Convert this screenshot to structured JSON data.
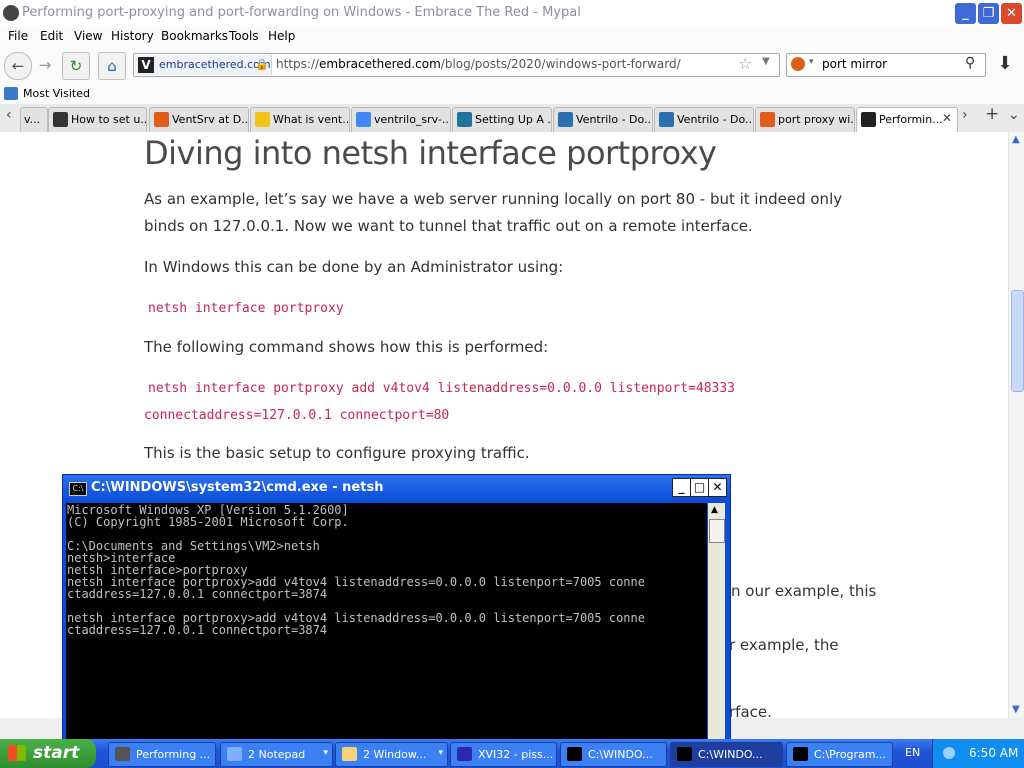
{
  "window": {
    "title": "Performing port-proxying and port-forwarding on Windows - Embrace The Red - Mypal"
  },
  "menu": [
    "File",
    "Edit",
    "View",
    "History",
    "Bookmarks",
    "Tools",
    "Help"
  ],
  "nav": {
    "identity_domain": "embracethered.com",
    "url_prefix": "https://",
    "url_host": "embracethered.com",
    "url_path": "/blog/posts/2020/windows-port-forward/",
    "search_value": "port mirror"
  },
  "bookmarks": {
    "most_visited": "Most Visited"
  },
  "tabs": [
    {
      "label": "v...",
      "color": "#cc9a33"
    },
    {
      "label": "How to set u...",
      "color": "#333333"
    },
    {
      "label": "VentSrv at D...",
      "color": "#e25d1b"
    },
    {
      "label": "What is vent...",
      "color": "#f0c419"
    },
    {
      "label": "ventrilo_srv-...",
      "color": "#4285f4"
    },
    {
      "label": "Setting Up A ...",
      "color": "#21759b"
    },
    {
      "label": "Ventrilo - Do...",
      "color": "#2a6fb0"
    },
    {
      "label": "Ventrilo - Do...",
      "color": "#2a6fb0"
    },
    {
      "label": "port proxy wi...",
      "color": "#e25d1b"
    },
    {
      "label": "Performin...",
      "color": "#222222"
    }
  ],
  "article": {
    "heading": "Diving into netsh interface portproxy",
    "p1": "As an example, let’s say we have a web server running locally on port 80 - but it indeed only binds on 127.0.0.1. Now we want to tunnel that traffic out on a remote interface.",
    "p2": "In Windows this can be done by an Administrator using:",
    "code1": "netsh interface portproxy",
    "p3": "The following command shows how this is performed:",
    "code2_line1": "netsh interface portproxy add v4tov4 listenaddress=0.0.0.0 listenport=48333",
    "code2_line2": "connectaddress=127.0.0.1 connectport=80",
    "p4": "This is the basic setup to configure proxying traffic.",
    "frag1": "n our example, this",
    "frag2": "r example, the",
    "frag3": "rface."
  },
  "cmd": {
    "title": "C:\\WINDOWS\\system32\\cmd.exe - netsh",
    "lines": [
      "Microsoft Windows XP [Version 5.1.2600]",
      "(C) Copyright 1985-2001 Microsoft Corp.",
      "",
      "C:\\Documents and Settings\\VM2>netsh",
      "netsh>interface",
      "netsh interface>portproxy",
      "netsh interface portproxy>add v4tov4 listenaddress=0.0.0.0 listenport=7005 conne",
      "ctaddress=127.0.0.1 connectport=3874",
      "",
      "netsh interface portproxy>add v4tov4 listenaddress=0.0.0.0 listenport=7005 conne",
      "ctaddress=127.0.0.1 connectport=3874"
    ]
  },
  "taskbar": {
    "start": "start",
    "items": [
      {
        "label": "Performing ...",
        "color": "#555555",
        "arrow": false,
        "active": false
      },
      {
        "label": "2 Notepad",
        "color": "#7fb0ff",
        "arrow": true,
        "active": false
      },
      {
        "label": "2 Window...",
        "color": "#f3d27a",
        "arrow": true,
        "active": false
      },
      {
        "label": "XVI32 - piss...",
        "color": "#2a2ab0",
        "arrow": false,
        "active": false
      },
      {
        "label": "C:\\WINDO...",
        "color": "#000000",
        "arrow": false,
        "active": false
      },
      {
        "label": "C:\\WINDO...",
        "color": "#000000",
        "arrow": false,
        "active": true
      },
      {
        "label": "C:\\Program...",
        "color": "#000000",
        "arrow": false,
        "active": false
      }
    ],
    "lang": "EN",
    "clock": "6:50 AM"
  }
}
